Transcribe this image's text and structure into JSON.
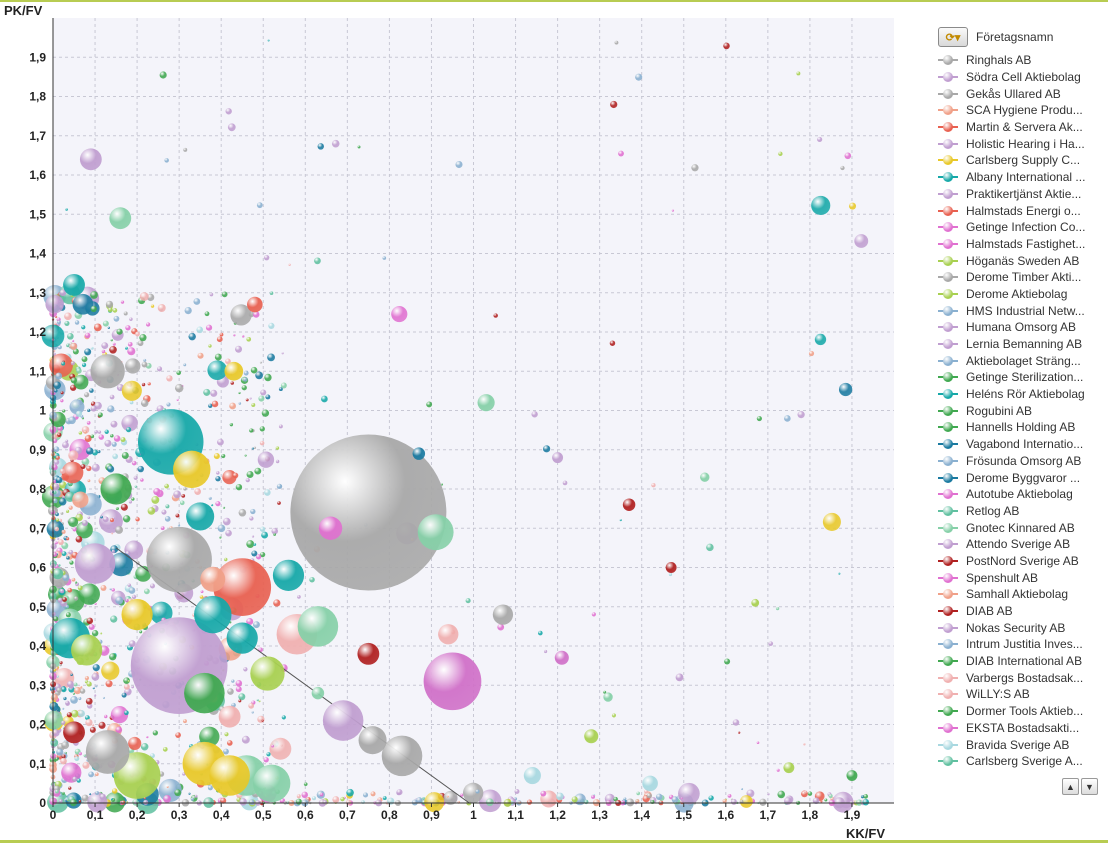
{
  "chart_data": {
    "type": "scatter",
    "subtype": "bubble",
    "title": "",
    "xlabel": "KK/FV",
    "ylabel": "PK/FV",
    "xlim": [
      0,
      2
    ],
    "ylim": [
      0,
      2
    ],
    "x_ticks": [
      "0",
      "0,1",
      "0,2",
      "0,3",
      "0,4",
      "0,5",
      "0,6",
      "0,7",
      "0,8",
      "0,9",
      "1",
      "1,1",
      "1,2",
      "1,3",
      "1,4",
      "1,5",
      "1,6",
      "1,7",
      "1,8",
      "1,9"
    ],
    "y_ticks": [
      "0",
      "0,1",
      "0,2",
      "0,3",
      "0,4",
      "0,5",
      "0,6",
      "0,7",
      "0,8",
      "0,9",
      "1",
      "1,1",
      "1,2",
      "1,3",
      "1,4",
      "1,5",
      "1,6",
      "1,7",
      "1,8",
      "1,9"
    ],
    "grid": true,
    "reference_line": {
      "from": [
        0.15,
        0.65
      ],
      "to": [
        0.99,
        0
      ]
    },
    "legend_position": "right",
    "points": [
      {
        "x": 0.75,
        "y": 0.74,
        "r": 1.0,
        "c": "#a8a8a8"
      },
      {
        "x": 0.95,
        "y": 0.31,
        "r": 0.37,
        "c": "#d070c8"
      },
      {
        "x": 0.45,
        "y": 0.55,
        "r": 0.37,
        "c": "#e86050"
      },
      {
        "x": 0.28,
        "y": 0.92,
        "r": 0.42,
        "c": "#16a8a8"
      },
      {
        "x": 0.3,
        "y": 0.35,
        "r": 0.62,
        "c": "#c09ed0"
      },
      {
        "x": 0.3,
        "y": 0.62,
        "r": 0.42,
        "c": "#a8a8a8"
      },
      {
        "x": 0.58,
        "y": 0.43,
        "r": 0.26,
        "c": "#f0b0b0"
      },
      {
        "x": 0.63,
        "y": 0.45,
        "r": 0.26,
        "c": "#86d0a8"
      },
      {
        "x": 0.83,
        "y": 0.12,
        "r": 0.26,
        "c": "#a8a8a8"
      },
      {
        "x": 0.69,
        "y": 0.21,
        "r": 0.26,
        "c": "#c09ed0"
      },
      {
        "x": 0.46,
        "y": 0.07,
        "r": 0.26,
        "c": "#86d0a8"
      },
      {
        "x": 0.52,
        "y": 0.05,
        "r": 0.24,
        "c": "#86d0a8"
      },
      {
        "x": 0.36,
        "y": 0.1,
        "r": 0.28,
        "c": "#e8c828"
      },
      {
        "x": 0.42,
        "y": 0.07,
        "r": 0.26,
        "c": "#e8c828"
      },
      {
        "x": 0.2,
        "y": 0.07,
        "r": 0.3,
        "c": "#a8d050"
      },
      {
        "x": 0.13,
        "y": 0.13,
        "r": 0.28,
        "c": "#a8a8a8"
      },
      {
        "x": 0.36,
        "y": 0.28,
        "r": 0.26,
        "c": "#40a850"
      },
      {
        "x": 0.51,
        "y": 0.33,
        "r": 0.22,
        "c": "#a8d050"
      },
      {
        "x": 0.33,
        "y": 0.85,
        "r": 0.24,
        "c": "#e8c828"
      },
      {
        "x": 0.38,
        "y": 0.48,
        "r": 0.24,
        "c": "#16a8a8"
      },
      {
        "x": 0.45,
        "y": 0.42,
        "r": 0.2,
        "c": "#16a8a8"
      },
      {
        "x": 0.56,
        "y": 0.58,
        "r": 0.2,
        "c": "#16a8a8"
      },
      {
        "x": 0.91,
        "y": 0.69,
        "r": 0.23,
        "c": "#86d0a8"
      },
      {
        "x": 0.66,
        "y": 0.7,
        "r": 0.15,
        "c": "#e070d0"
      },
      {
        "x": 0.76,
        "y": 0.16,
        "r": 0.18,
        "c": "#a8a8a8"
      },
      {
        "x": 0.75,
        "y": 0.38,
        "r": 0.14,
        "c": "#b02020"
      },
      {
        "x": 0.38,
        "y": 0.57,
        "r": 0.16,
        "c": "#f0a088"
      },
      {
        "x": 0.08,
        "y": 0.39,
        "r": 0.2,
        "c": "#a8d050"
      },
      {
        "x": 0.1,
        "y": 0.61,
        "r": 0.26,
        "c": "#c09ed0"
      },
      {
        "x": 0.09,
        "y": 1.64,
        "r": 0.14,
        "c": "#c09ed0"
      },
      {
        "x": 0.16,
        "y": 1.49,
        "r": 0.14,
        "c": "#86d0a8"
      },
      {
        "x": 0.05,
        "y": 1.32,
        "r": 0.14,
        "c": "#16a8a8"
      },
      {
        "x": 0.04,
        "y": 0.42,
        "r": 0.26,
        "c": "#16a8a8"
      },
      {
        "x": 0.13,
        "y": 1.1,
        "r": 0.22,
        "c": "#a8a8a8"
      },
      {
        "x": 0.43,
        "y": 1.1,
        "r": 0.12,
        "c": "#e8c828"
      },
      {
        "x": 0.48,
        "y": 1.27,
        "r": 0.1,
        "c": "#e86050"
      },
      {
        "x": 1.03,
        "y": 1.02,
        "r": 0.11,
        "c": "#86d0a8"
      },
      {
        "x": 1.07,
        "y": 0.48,
        "r": 0.13,
        "c": "#a8a8a8"
      },
      {
        "x": 0.94,
        "y": 0.43,
        "r": 0.13,
        "c": "#f0b0b0"
      },
      {
        "x": 1.21,
        "y": 0.37,
        "r": 0.09,
        "c": "#d070c8"
      },
      {
        "x": 1.37,
        "y": 0.76,
        "r": 0.08,
        "c": "#b02020"
      },
      {
        "x": 1.47,
        "y": 0.6,
        "r": 0.07,
        "c": "#b02020"
      },
      {
        "x": 1.2,
        "y": 0.88,
        "r": 0.07,
        "c": "#c09ed0"
      },
      {
        "x": 1.28,
        "y": 0.17,
        "r": 0.09,
        "c": "#a8d050"
      },
      {
        "x": 1.14,
        "y": 0.07,
        "r": 0.11,
        "c": "#a8d8e0"
      },
      {
        "x": 1.42,
        "y": 0.05,
        "r": 0.1,
        "c": "#a8d8e0"
      },
      {
        "x": 1.55,
        "y": 0.83,
        "r": 0.06,
        "c": "#86d0a8"
      },
      {
        "x": 1.67,
        "y": 0.51,
        "r": 0.05,
        "c": "#a8d050"
      },
      {
        "x": 1.75,
        "y": 0.09,
        "r": 0.07,
        "c": "#a8d050"
      },
      {
        "x": 1.9,
        "y": 0.07,
        "r": 0.07,
        "c": "#40a850"
      },
      {
        "x": 0.42,
        "y": 0.22,
        "r": 0.14,
        "c": "#f0b0b0"
      },
      {
        "x": 0.35,
        "y": 0.73,
        "r": 0.18,
        "c": "#16a8a8"
      },
      {
        "x": 0.15,
        "y": 0.8,
        "r": 0.2,
        "c": "#40a850"
      },
      {
        "x": 0.2,
        "y": 0.48,
        "r": 0.2,
        "c": "#e8c828"
      },
      {
        "x": 0.05,
        "y": 0.18,
        "r": 0.14,
        "c": "#b02020"
      },
      {
        "x": 0.63,
        "y": 0.28,
        "r": 0.08,
        "c": "#86d0a8"
      },
      {
        "x": 0.87,
        "y": 0.89,
        "r": 0.08,
        "c": "#1a7aa0"
      },
      {
        "x": 1.32,
        "y": 0.27,
        "r": 0.06,
        "c": "#86d0a8"
      },
      {
        "x": 1.49,
        "y": 0.32,
        "r": 0.05,
        "c": "#c09ed0"
      }
    ]
  },
  "axis": {
    "x_title": "KK/FV",
    "y_title": "PK/FV"
  },
  "legend": {
    "title": "Företagsnamn",
    "cycle_icon": "cycle-colors-icon",
    "items": [
      {
        "label": "Ringhals AB",
        "color": "#a8a8a8"
      },
      {
        "label": "Södra Cell Aktiebolag",
        "color": "#c09ed0"
      },
      {
        "label": "Gekås Ullared AB",
        "color": "#a8a8a8"
      },
      {
        "label": "SCA Hygiene Produ...",
        "color": "#f0a088"
      },
      {
        "label": "Martin & Servera Ak...",
        "color": "#e86050"
      },
      {
        "label": "Holistic Hearing i Ha...",
        "color": "#c09ed0"
      },
      {
        "label": "Carlsberg Supply C...",
        "color": "#e8c828"
      },
      {
        "label": "Albany International ...",
        "color": "#16a8a8"
      },
      {
        "label": "Praktikertjänst Aktie...",
        "color": "#c09ed0"
      },
      {
        "label": "Halmstads Energi o...",
        "color": "#e86050"
      },
      {
        "label": "Getinge Infection Co...",
        "color": "#e070d0"
      },
      {
        "label": "Halmstads Fastighet...",
        "color": "#e070d0"
      },
      {
        "label": "Höganäs Sweden AB",
        "color": "#a8d050"
      },
      {
        "label": "Derome Timber Akti...",
        "color": "#a8a8a8"
      },
      {
        "label": "Derome Aktiebolag",
        "color": "#a8d050"
      },
      {
        "label": "HMS Industrial Netw...",
        "color": "#8ab0d0"
      },
      {
        "label": "Humana Omsorg AB",
        "color": "#c09ed0"
      },
      {
        "label": "Lernia Bemanning AB",
        "color": "#c09ed0"
      },
      {
        "label": "Aktiebolaget Sträng...",
        "color": "#8ab0d0"
      },
      {
        "label": "Getinge Sterilization...",
        "color": "#40a850"
      },
      {
        "label": "Heléns Rör Aktiebolag",
        "color": "#16a8a8"
      },
      {
        "label": "Rogubini AB",
        "color": "#40a850"
      },
      {
        "label": "Hannells Holding AB",
        "color": "#40a850"
      },
      {
        "label": "Vagabond Internatio...",
        "color": "#1a7aa0"
      },
      {
        "label": "Frösunda Omsorg AB",
        "color": "#8ab0d0"
      },
      {
        "label": "Derome Byggvaror ...",
        "color": "#1a7aa0"
      },
      {
        "label": "Autotube Aktiebolag",
        "color": "#e070d0"
      },
      {
        "label": "Retlog AB",
        "color": "#60c0a0"
      },
      {
        "label": "Gnotec Kinnared AB",
        "color": "#86d0a8"
      },
      {
        "label": "Attendo Sverige AB",
        "color": "#c09ed0"
      },
      {
        "label": "PostNord Sverige AB",
        "color": "#b02020"
      },
      {
        "label": "Spenshult AB",
        "color": "#e070d0"
      },
      {
        "label": "Samhall Aktiebolag",
        "color": "#f0a088"
      },
      {
        "label": "DIAB AB",
        "color": "#b02020"
      },
      {
        "label": "Nokas Security AB",
        "color": "#c09ed0"
      },
      {
        "label": "Intrum Justitia Inves...",
        "color": "#8ab0d0"
      },
      {
        "label": "DIAB International AB",
        "color": "#40a850"
      },
      {
        "label": "Varbergs Bostadsak...",
        "color": "#f0b0b0"
      },
      {
        "label": "WiLLY:S AB",
        "color": "#f0b0b0"
      },
      {
        "label": "Dormer Tools Aktieb...",
        "color": "#40a850"
      },
      {
        "label": "EKSTA Bostadsakti...",
        "color": "#e070d0"
      },
      {
        "label": "Bravida Sverige AB",
        "color": "#a8d8e0"
      },
      {
        "label": "Carlsberg Sverige A...",
        "color": "#60c0a0"
      }
    ],
    "scroll_up_icon": "chevron-up-icon",
    "scroll_down_icon": "chevron-down-icon"
  }
}
